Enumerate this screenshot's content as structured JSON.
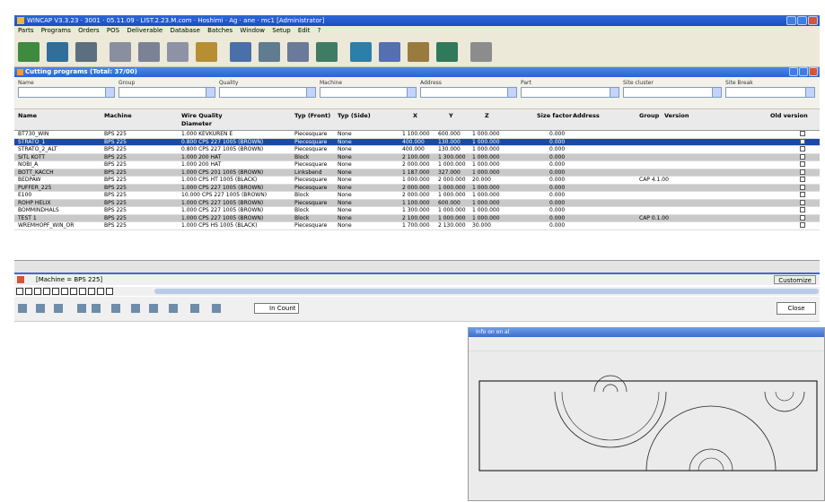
{
  "window": {
    "title": "WINCAP V3.3.23 · 3001 · 05.11.09 · LIST.2.23.M.com · Hoshimi · Ag · ane · mc1 [Administrator]"
  },
  "menubar": [
    "Parts",
    "Programs",
    "Orders",
    "POS",
    "Deliverable",
    "Database",
    "Batches",
    "Window",
    "Setup",
    "Edit",
    "?"
  ],
  "panel": {
    "title": "Cutting programs (Total: 37/00)"
  },
  "filters": [
    {
      "label": "Name",
      "value": ""
    },
    {
      "label": "Group",
      "value": ""
    },
    {
      "label": "Quality",
      "value": ""
    },
    {
      "label": "Machine",
      "value": ""
    },
    {
      "label": "Address",
      "value": ""
    },
    {
      "label": "Part",
      "value": ""
    },
    {
      "label": "Site cluster",
      "value": ""
    },
    {
      "label": "Site Break",
      "value": ""
    }
  ],
  "columns": {
    "name": "Name",
    "machine": "Machine",
    "wire_diameter": "Wire Quality",
    "diameter2": "Diameter",
    "typ_front": "Typ (Front)",
    "typ_side": "Typ (Side)",
    "x": "X",
    "y": "Y",
    "z": "Z",
    "size_factor": "Size factor",
    "address": "Address",
    "group": "Group",
    "version": "Version",
    "old_version": "Old version"
  },
  "rows": [
    {
      "name": "BT730_WIN",
      "machine": "BPS 225",
      "wire": "1.000 KEVKUREN E",
      "front": "Piecesquare",
      "side": "None",
      "x": "1 100.000",
      "y": "600.000",
      "z": "1 000.000",
      "sf": "0.000",
      "address": "",
      "group": "",
      "style": "normal"
    },
    {
      "name": "STRATO_1",
      "machine": "BPS 225",
      "wire": "0.800 CPS 227 1005 (BROWN)",
      "front": "Piecesquare",
      "side": "None",
      "x": "400.000",
      "y": "130.000",
      "z": "1 000.000",
      "sf": "0.000",
      "address": "",
      "group": "",
      "style": "sel"
    },
    {
      "name": "STRATO_2_ALT",
      "machine": "BPS 225",
      "wire": "0.800 CPS 227 1005 (BROWN)",
      "front": "Piecesquare",
      "side": "None",
      "x": "400.000",
      "y": "130.000",
      "z": "1 000.000",
      "sf": "0.000",
      "address": "",
      "group": "",
      "style": "normal"
    },
    {
      "name": "SITL KOTT",
      "machine": "BPS 225",
      "wire": "1.000 200 HAT",
      "front": "Block",
      "side": "None",
      "x": "2 100.000",
      "y": "1 300.000",
      "z": "1 000.000",
      "sf": "0.000",
      "address": "",
      "group": "",
      "style": "alt"
    },
    {
      "name": "NOBI_A",
      "machine": "BPS 225",
      "wire": "1.000 200 HAT",
      "front": "Piecesquare",
      "side": "None",
      "x": "2 000.000",
      "y": "1 000.000",
      "z": "1 000.000",
      "sf": "0.000",
      "address": "",
      "group": "",
      "style": "normal"
    },
    {
      "name": "BOTT_KACCH",
      "machine": "BPS 225",
      "wire": "1.000 CPS 201 1005 (BROWN)",
      "front": "Linksbend",
      "side": "None",
      "x": "1 187.000",
      "y": "327.000",
      "z": "1 000.000",
      "sf": "0.000",
      "address": "",
      "group": "",
      "style": "alt"
    },
    {
      "name": "BEDPAW",
      "machine": "BPS 225",
      "wire": "1.000 CPS HT 1005 (BLACK)",
      "front": "Piecesquare",
      "side": "None",
      "x": "1 000.000",
      "y": "2 000.000",
      "z": "20.000",
      "sf": "0.000",
      "address": "",
      "group": "CAP 4.1.00",
      "style": "normal"
    },
    {
      "name": "PUFFER_225",
      "machine": "BPS 225",
      "wire": "1.000 CPS 227 1005 (BROWN)",
      "front": "Piecesquare",
      "side": "None",
      "x": "2 000.000",
      "y": "1 000.000",
      "z": "1 000.000",
      "sf": "0.000",
      "address": "",
      "group": "",
      "style": "alt"
    },
    {
      "name": "E100",
      "machine": "BPS 225",
      "wire": "10.000 CPS 227 1005 (BROWN)",
      "front": "Block",
      "side": "None",
      "x": "2 000.000",
      "y": "1 000.000",
      "z": "1 000.000",
      "sf": "0.000",
      "address": "",
      "group": "",
      "style": "normal"
    },
    {
      "name": "ROHP HELIX",
      "machine": "BPS 225",
      "wire": "1.000 CPS 227 1005 (BROWN)",
      "front": "Piecesquare",
      "side": "None",
      "x": "1 100.000",
      "y": "600.000",
      "z": "1 000.000",
      "sf": "0.000",
      "address": "",
      "group": "",
      "style": "alt"
    },
    {
      "name": "BOMMINDHALS",
      "machine": "BPS 225",
      "wire": "1.000 CPS 227 1005 (BROWN)",
      "front": "Block",
      "side": "None",
      "x": "1 300.000",
      "y": "1 000.000",
      "z": "1 000.000",
      "sf": "0.000",
      "address": "",
      "group": "",
      "style": "normal"
    },
    {
      "name": "TEST 1",
      "machine": "BPS 225",
      "wire": "1.000 CPS 227 1005 (BROWN)",
      "front": "Block",
      "side": "None",
      "x": "2 100.000",
      "y": "1 000.000",
      "z": "1 000.000",
      "sf": "0.000",
      "address": "",
      "group": "CAP 0.1.00",
      "style": "alt"
    },
    {
      "name": "WREMHOPF_WIN_OR",
      "machine": "BPS 225",
      "wire": "1.000 CPS HS 1005 (BLACK)",
      "front": "Piecesquare",
      "side": "None",
      "x": "1 700.000",
      "y": "2 130.000",
      "z": "30.000",
      "sf": "0.000",
      "address": "",
      "group": "",
      "style": "normal"
    }
  ],
  "status": {
    "filter_text": "[Machine = BPS 225]",
    "customize_label": "Customize"
  },
  "bottom": {
    "incount_label": "In Count",
    "close_label": "Close"
  },
  "preview": {
    "title": "Info on on al"
  }
}
